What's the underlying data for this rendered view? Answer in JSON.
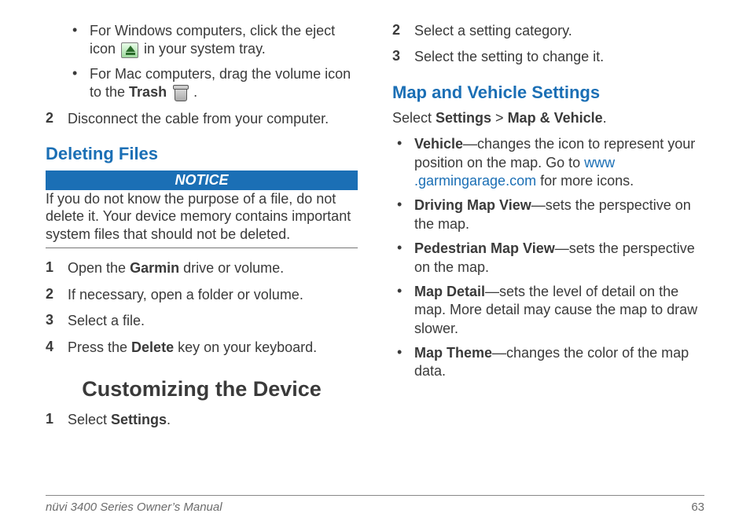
{
  "left": {
    "bullets": [
      {
        "pre": "For Windows computers, click the eject icon ",
        "icon": "eject",
        "post": " in your system tray."
      },
      {
        "pre": "For Mac computers, drag the volume icon to the ",
        "bold": "Trash",
        "icon": "trash",
        "post": " ."
      }
    ],
    "step2_num": "2",
    "step2_text": "Disconnect the cable from your computer.",
    "h_deleting": "Deleting Files",
    "notice_label": "NOTICE",
    "notice_text": "If you do not know the purpose of a file, do not delete it. Your device memory contains important system files that should not be deleted.",
    "del_steps": [
      {
        "n": "1",
        "pre": "Open the ",
        "bold": "Garmin",
        "post": " drive or volume."
      },
      {
        "n": "2",
        "pre": "If necessary, open a folder or volume.",
        "bold": "",
        "post": ""
      },
      {
        "n": "3",
        "pre": "Select a file.",
        "bold": "",
        "post": ""
      },
      {
        "n": "4",
        "pre": "Press the ",
        "bold": "Delete",
        "post": " key on your keyboard."
      }
    ],
    "h_custom": "Customizing the Device",
    "cust_step1_num": "1",
    "cust_step1_pre": "Select ",
    "cust_step1_bold": "Settings",
    "cust_step1_post": "."
  },
  "right": {
    "steps_top": [
      {
        "n": "2",
        "text": "Select a setting category."
      },
      {
        "n": "3",
        "text": "Select the setting to change it."
      }
    ],
    "h_map": "Map and Vehicle Settings",
    "path_pre": "Select ",
    "path_b1": "Settings",
    "path_sep": " > ",
    "path_b2": "Map & Vehicle",
    "path_post": ".",
    "items": [
      {
        "bold": "Vehicle",
        "pre": "—changes the icon to represent your position on the map. Go to ",
        "link": "www\n.garmingarage.com",
        "post": " for more icons."
      },
      {
        "bold": "Driving Map View",
        "pre": "—sets the perspective on the map.",
        "link": "",
        "post": ""
      },
      {
        "bold": "Pedestrian Map View",
        "pre": "—sets the perspective on the map.",
        "link": "",
        "post": ""
      },
      {
        "bold": "Map Detail",
        "pre": "—sets the level of detail on the map. More detail may cause the map to draw slower.",
        "link": "",
        "post": ""
      },
      {
        "bold": "Map Theme",
        "pre": "—changes the color of the map data.",
        "link": "",
        "post": ""
      }
    ]
  },
  "footer": {
    "title": "nüvi 3400 Series Owner’s Manual",
    "page": "63"
  }
}
